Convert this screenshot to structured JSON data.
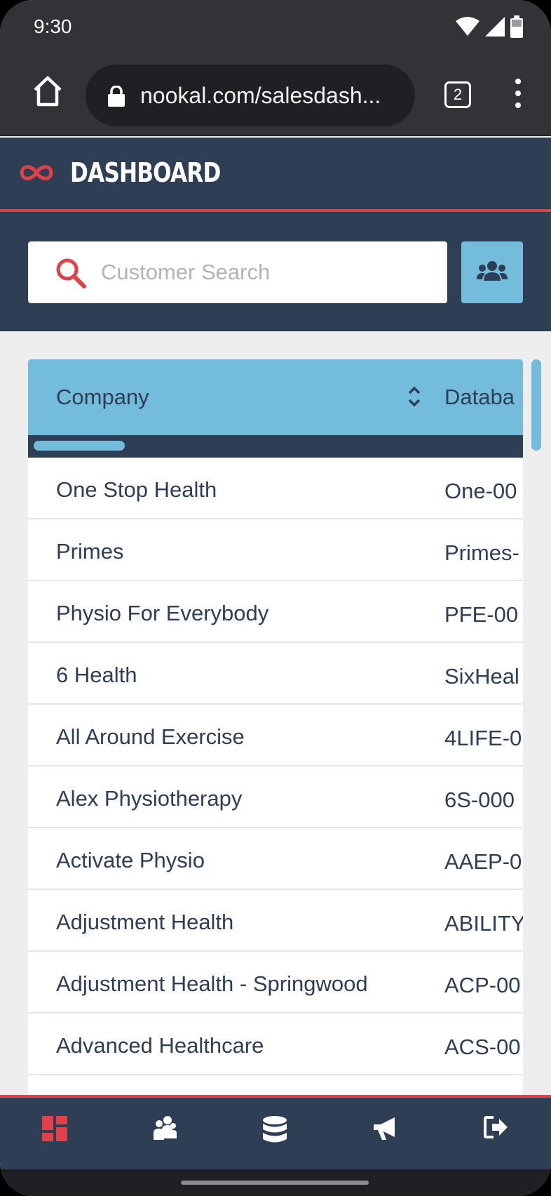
{
  "status_bar": {
    "time": "9:30"
  },
  "browser": {
    "url": "nookal.com/salesdash...",
    "tab_count": "2"
  },
  "header": {
    "title": "DASHBOARD",
    "accent_color": "#e14249",
    "brand_color": "#2d3e55"
  },
  "search": {
    "placeholder": "Customer Search"
  },
  "table": {
    "columns": [
      "Company",
      "Databa"
    ],
    "rows": [
      {
        "company": "One Stop Health",
        "database": "One-00"
      },
      {
        "company": "Primes",
        "database": "Primes-"
      },
      {
        "company": "Physio For Everybody",
        "database": "PFE-00"
      },
      {
        "company": "6 Health",
        "database": "SixHeal"
      },
      {
        "company": "All Around Exercise",
        "database": "4LIFE-0"
      },
      {
        "company": "Alex Physiotherapy",
        "database": "6S-000"
      },
      {
        "company": "Activate Physio",
        "database": "AAEP-0"
      },
      {
        "company": "Adjustment Health",
        "database": "ABILITY"
      },
      {
        "company": "Adjustment Health - Springwood",
        "database": "ACP-00"
      },
      {
        "company": "Advanced Healthcare",
        "database": "ACS-00"
      }
    ]
  },
  "bottom_nav": {
    "items": [
      {
        "icon": "dashboard-icon",
        "active": true
      },
      {
        "icon": "customers-icon",
        "active": false
      },
      {
        "icon": "database-icon",
        "active": false
      },
      {
        "icon": "megaphone-icon",
        "active": false
      },
      {
        "icon": "logout-icon",
        "active": false
      }
    ]
  }
}
